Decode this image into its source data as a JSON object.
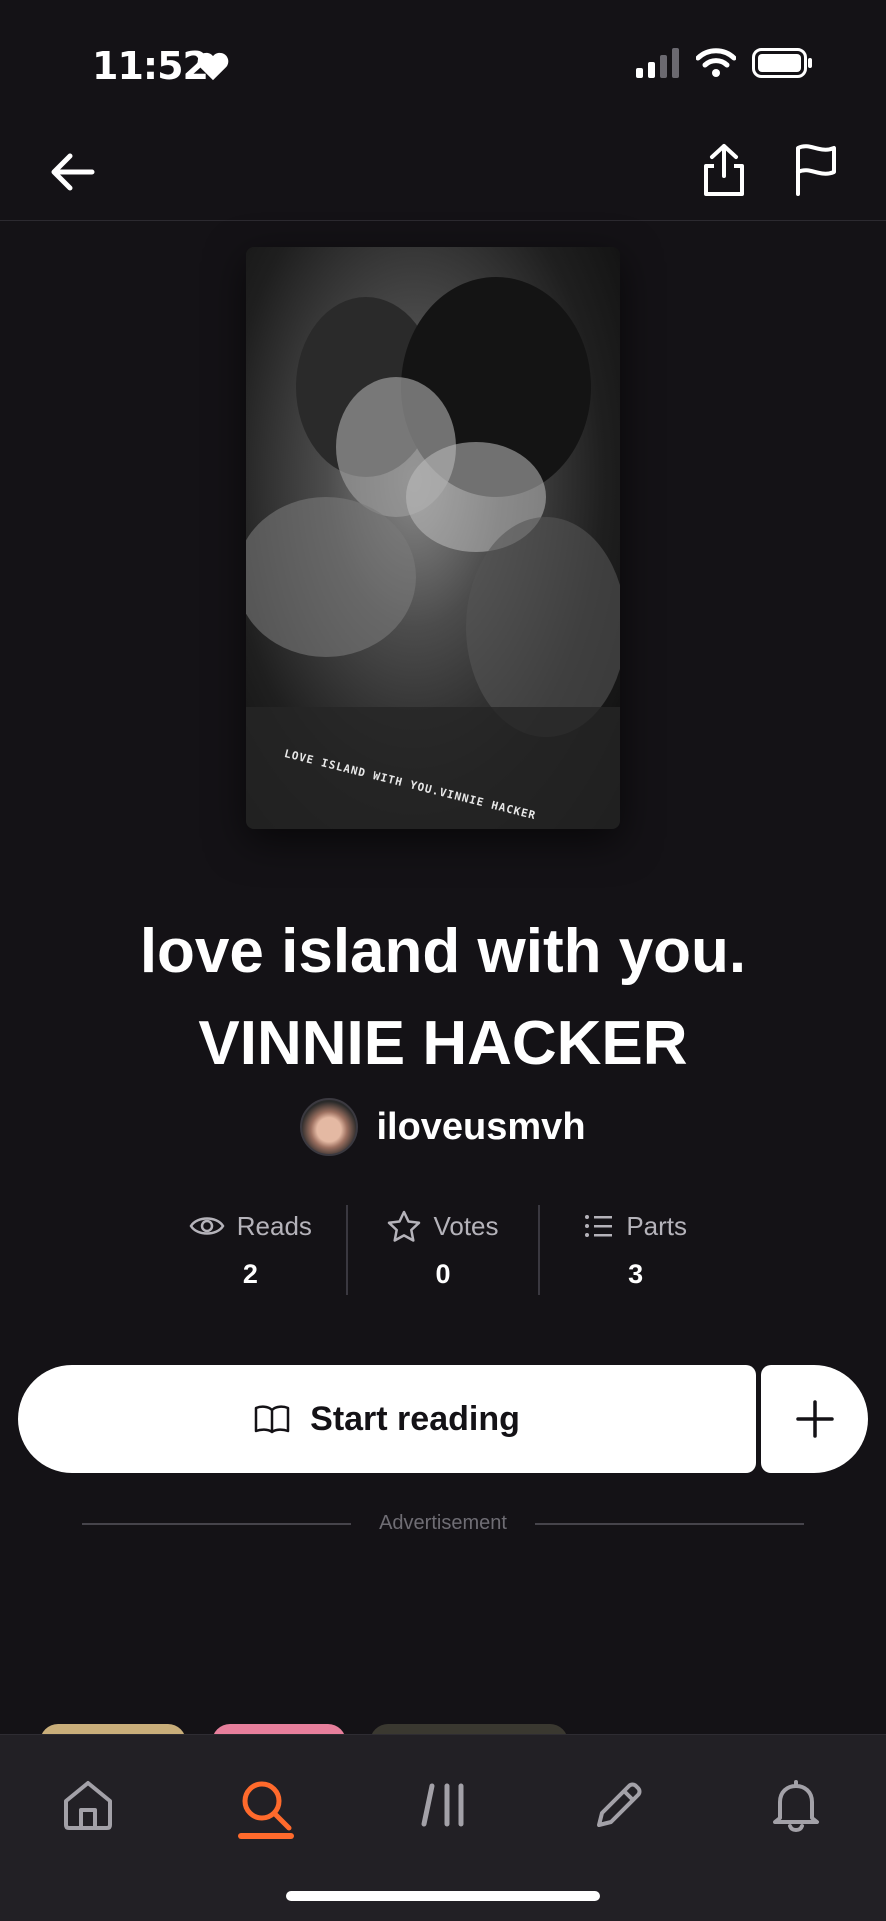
{
  "status": {
    "time": "11:52"
  },
  "story": {
    "cover_caption": "LOVE ISLAND WITH YOU.VINNIE HACKER",
    "title_line1": "love island with you.",
    "title_line2": "VINNIE HACKER",
    "author": "iloveusmvh"
  },
  "stats": [
    {
      "label": "Reads",
      "value": "2",
      "icon": "eye-icon"
    },
    {
      "label": "Votes",
      "value": "0",
      "icon": "star-icon"
    },
    {
      "label": "Parts",
      "value": "3",
      "icon": "list-icon"
    }
  ],
  "actions": {
    "start_label": "Start reading"
  },
  "ad": {
    "label": "Advertisement"
  },
  "tabs": [
    {
      "name": "home",
      "icon": "home-icon"
    },
    {
      "name": "search",
      "icon": "search-icon",
      "active": true
    },
    {
      "name": "library",
      "icon": "library-icon"
    },
    {
      "name": "write",
      "icon": "pencil-icon"
    },
    {
      "name": "notifications",
      "icon": "bell-icon"
    }
  ],
  "colors": {
    "accent": "#ff6a2c",
    "background": "#141216",
    "tabbar": "#222025"
  }
}
